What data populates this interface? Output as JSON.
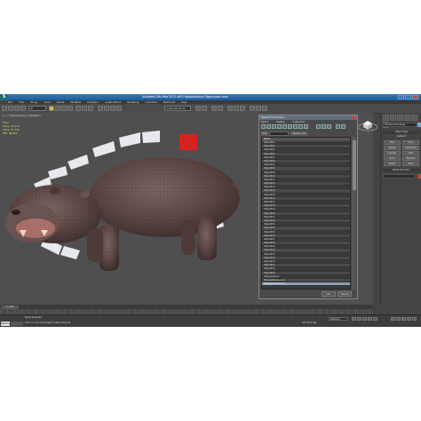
{
  "app": {
    "title": "Autodesk 3ds Max 2012 x64    Hippopotamus Pygmy.max.max",
    "logo_glyph": "S",
    "accent": "#2b6aa8"
  },
  "menu": [
    "Edit",
    "Tools",
    "Group",
    "Views",
    "Create",
    "Modifiers",
    "Animation",
    "Graph Editors",
    "Rendering",
    "Customize",
    "MAXScript",
    "Help"
  ],
  "toolbar": {
    "selection_filter": "All",
    "named_set": "Create Selection Se"
  },
  "viewport": {
    "label": "[ + ] [ Perspective ] [ Realistic ]",
    "stats": {
      "total_label": "Total",
      "polys_label": "Polys:",
      "polys": "26,122",
      "verts_label": "Verts:",
      "verts": "27,344",
      "fps_label": "FPS:",
      "fps": "98.802"
    }
  },
  "dialog": {
    "title": "Select From Scene",
    "menu": [
      "Select",
      "Display",
      "Customize"
    ],
    "find_label": "Find:",
    "selection_set_label": "Selection Set:",
    "column_header": "Name",
    "rows": [
      "Object001",
      "Object002",
      "Object003",
      "Object004",
      "Object005",
      "Object006",
      "Object007",
      "Object008",
      "Object009",
      "Object010",
      "Object011",
      "Object012",
      "Object013",
      "Object014",
      "Object015",
      "Object016",
      "Object017",
      "Object018",
      "Object019",
      "Object020",
      "Object021",
      "Object022",
      "Object023",
      "Object024",
      "Object025",
      "Object026",
      "Object027",
      "Object028",
      "Object029",
      "Object030",
      "Object031",
      "Object032",
      "Object033",
      "Object034",
      "Object035",
      "Object036",
      "Hippopotamus",
      "Hippopotamus_Lmo",
      "Hippopotamus_Lmo..."
    ],
    "selected_index": 38,
    "ok_label": "OK",
    "cancel_label": "Cancel"
  },
  "right_panel": {
    "name_field": "Standard Primitives",
    "object_type_header": "Object Type",
    "autogrid_label": "AutoGrid",
    "buttons": [
      "Box",
      "Cone",
      "Sphere",
      "GeoSphere",
      "Cylinder",
      "Tube",
      "Torus",
      "Pyramid",
      "Teapot",
      "Plane"
    ],
    "name_color_header": "Name and Color"
  },
  "timeline": {
    "slider_label": "0 / 100"
  },
  "status": {
    "selection_text": "None Selected",
    "prompt_text": "Click or click-and-drag to select objects",
    "maxscript_label": "Welcome to M",
    "auto_key": "Selected",
    "add_time_tag": "Add Time Tag"
  }
}
